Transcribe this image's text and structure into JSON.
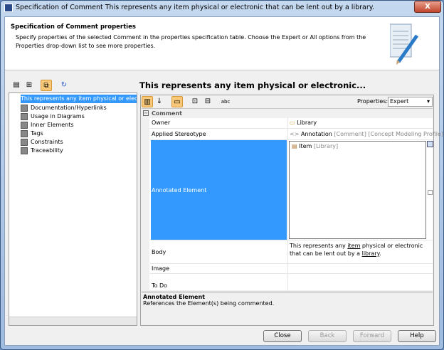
{
  "window": {
    "title": "Specification of Comment This represents any item physical or electronic that can be lent out by a library.",
    "close_label": "X"
  },
  "header": {
    "title": "Specification of Comment properties",
    "description": "Specify properties of the selected Comment in the properties specification table. Choose the Expert or All options from the Properties drop-down list to see more properties."
  },
  "panel_title": "This represents any item physical or electronic...",
  "tree": {
    "root": "This represents any item physical or electron",
    "items": [
      "Documentation/Hyperlinks",
      "Usage in Diagrams",
      "Inner Elements",
      "Tags",
      "Constraints",
      "Traceability"
    ]
  },
  "properties": {
    "label": "Properties:",
    "value": "Expert"
  },
  "table": {
    "group": "Comment",
    "owner": {
      "label": "Owner",
      "value": "Library"
    },
    "stereotype": {
      "label": "Applied Stereotype",
      "value": "Annotation",
      "meta1": "[Comment]",
      "meta2": "[Concept Modeling Profile]"
    },
    "annotated": {
      "label": "Annotated Element",
      "item": "Item",
      "item_meta": "[Library]"
    },
    "body": {
      "label": "Body",
      "v1": "This represents any ",
      "link1": "item",
      "v2": " physical or electronic that can be lent out by a ",
      "link2": "library",
      "v3": "."
    },
    "image": {
      "label": "Image"
    },
    "todo": {
      "label": "To Do"
    }
  },
  "description": {
    "title": "Annotated Element",
    "text": "References the Element(s) being commented."
  },
  "buttons": {
    "close": "Close",
    "back": "Back",
    "forward": "Forward",
    "help": "Help"
  }
}
